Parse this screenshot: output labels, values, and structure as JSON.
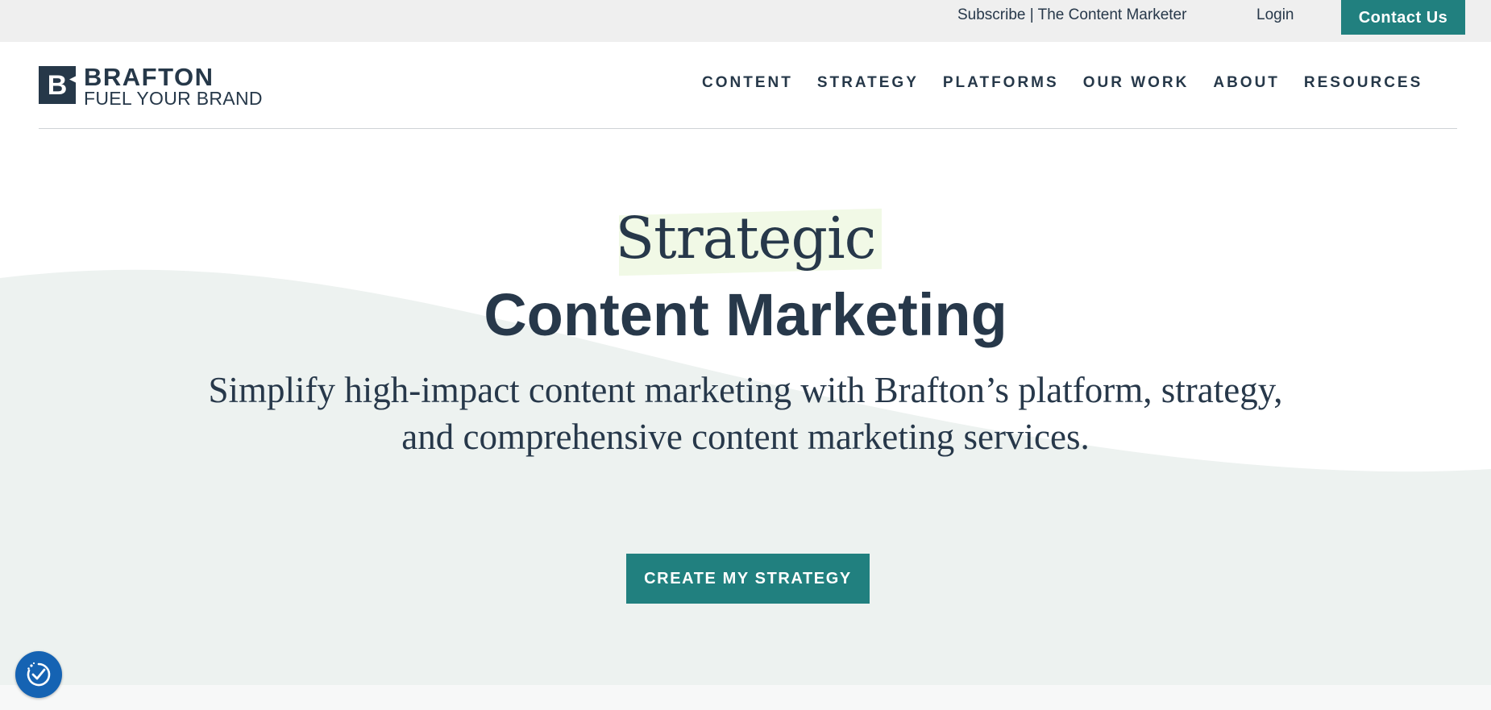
{
  "topbar": {
    "subscribe_label": "Subscribe | The Content Marketer",
    "login_label": "Login",
    "contact_label": "Contact Us"
  },
  "logo": {
    "mark_letter": "B",
    "brand": "BRAFTON",
    "tagline": "FUEL YOUR BRAND"
  },
  "nav": {
    "items": [
      {
        "label": "CONTENT"
      },
      {
        "label": "STRATEGY"
      },
      {
        "label": "PLATFORMS"
      },
      {
        "label": "OUR WORK"
      },
      {
        "label": "ABOUT"
      },
      {
        "label": "RESOURCES"
      }
    ]
  },
  "hero": {
    "title_line1": "Strategic",
    "title_line2": "Content Marketing",
    "subtitle_line1": "Simplify high-impact content marketing with Brafton’s platform, strategy,",
    "subtitle_line2": "and comprehensive content marketing services.",
    "cta_label": "CREATE MY STRATEGY"
  },
  "colors": {
    "accent": "#21807f",
    "text": "#27384a",
    "wave": "#edf2f0",
    "highlight": "#f1f9e6",
    "consent": "#1563b3"
  },
  "icons": {
    "consent": "privacy-consent-icon"
  }
}
